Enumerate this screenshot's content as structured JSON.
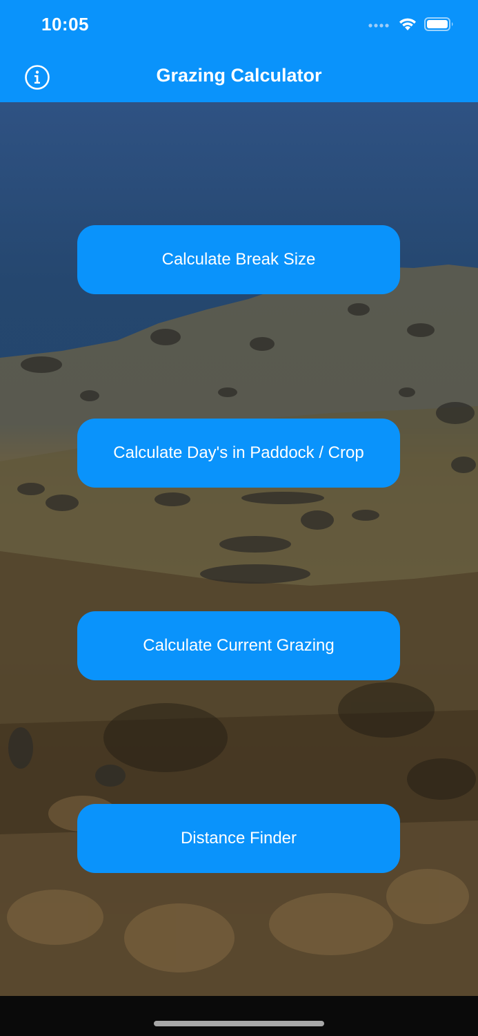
{
  "status_bar": {
    "time": "10:05",
    "icons": [
      "cellular-dots-icon",
      "wifi-icon",
      "battery-icon"
    ]
  },
  "nav": {
    "title": "Grazing Calculator",
    "info_icon": "info-icon"
  },
  "main": {
    "buttons": [
      {
        "label": "Calculate Break Size"
      },
      {
        "label": "Calculate Day's in Paddock / Crop"
      },
      {
        "label": "Calculate Current Grazing"
      },
      {
        "label": "Distance Finder"
      }
    ]
  },
  "colors": {
    "accent": "#0a93fb",
    "button_text": "#ffffff"
  }
}
